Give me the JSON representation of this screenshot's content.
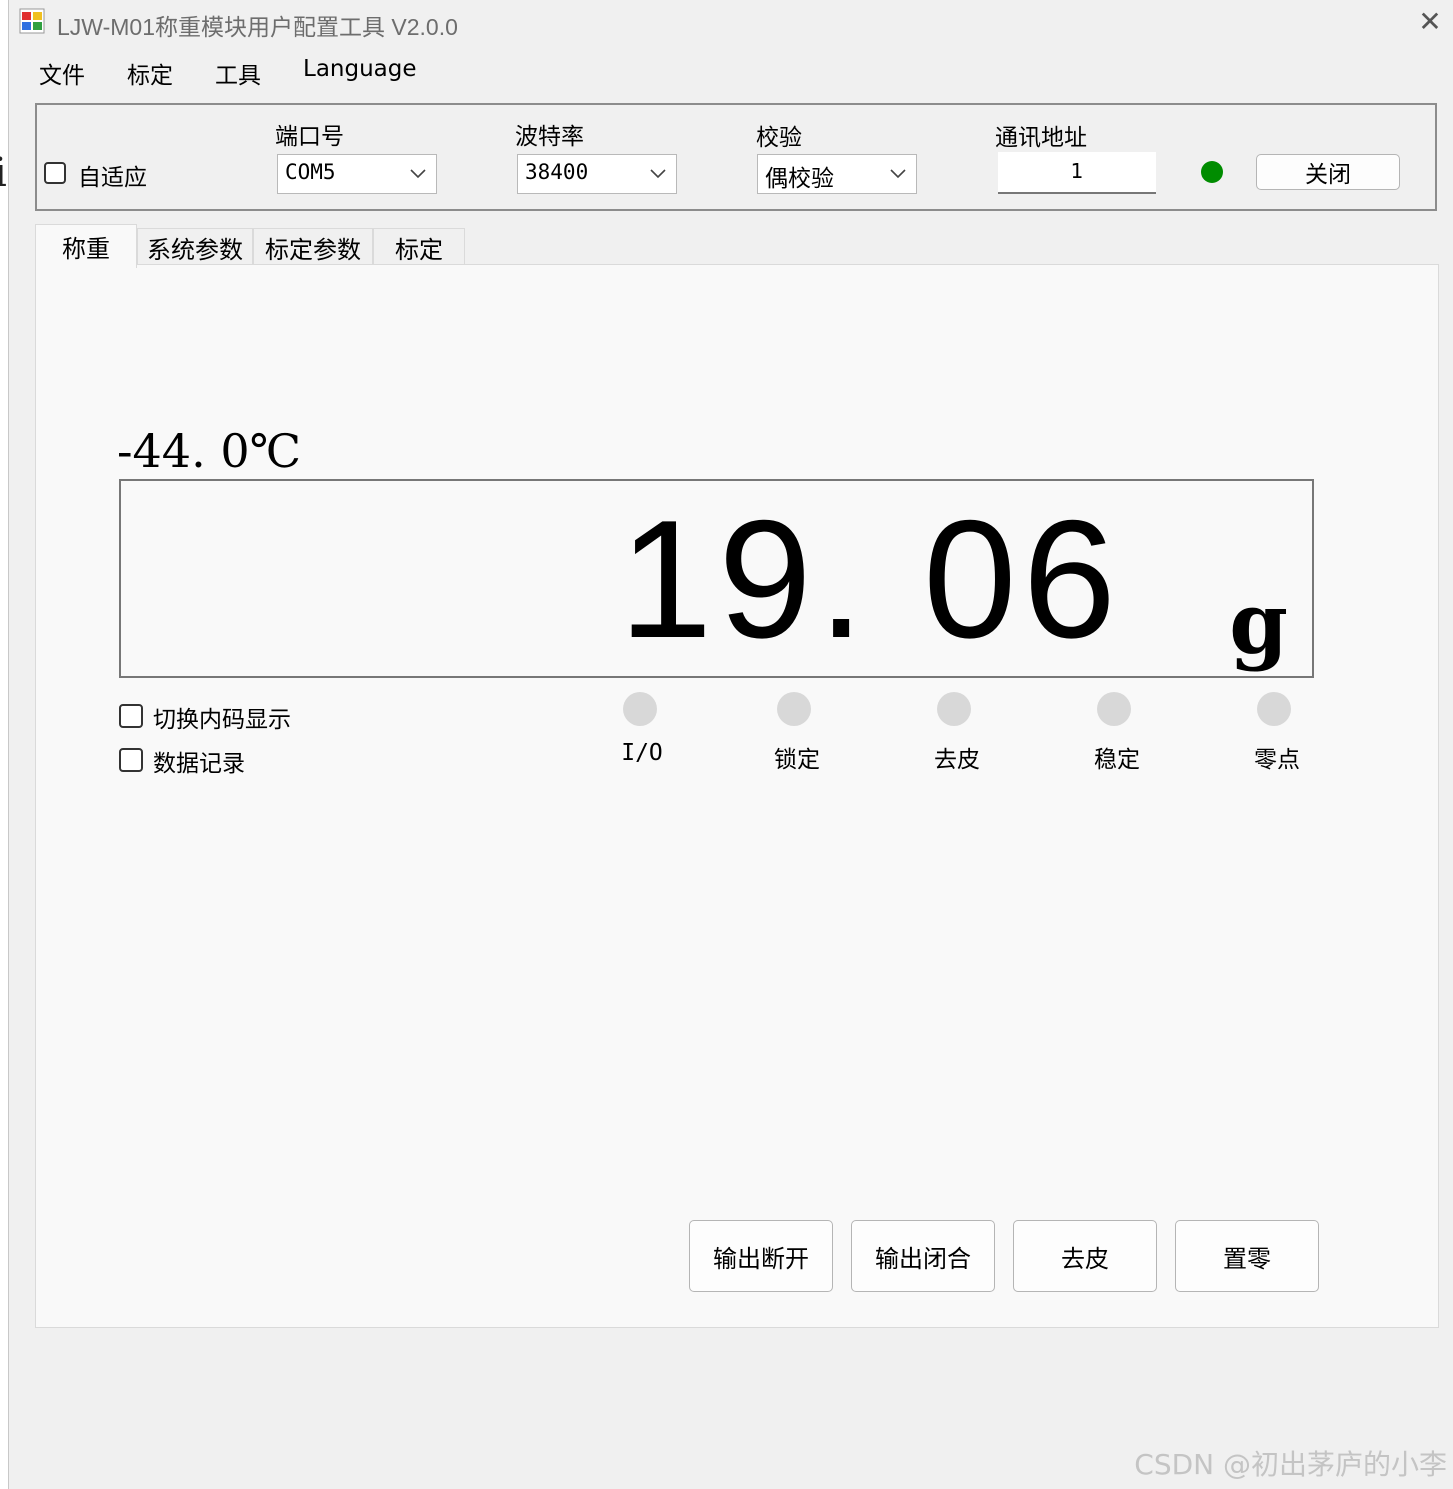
{
  "window": {
    "title": "LJW-M01称重模块用户配置工具 V2.0.0",
    "close_glyph": "✕"
  },
  "menu": [
    "文件",
    "标定",
    "工具",
    "Language"
  ],
  "connection": {
    "adaptive_label": "自适应",
    "adaptive_checked": false,
    "port_label": "端口号",
    "port_value": "COM5",
    "baud_label": "波特率",
    "baud_value": "38400",
    "parity_label": "校验",
    "parity_value": "偶校验",
    "address_label": "通讯地址",
    "address_value": "1",
    "status_led_color": "#008c00",
    "close_button_label": "关闭"
  },
  "tabs": [
    "称重",
    "系统参数",
    "标定参数",
    "标定"
  ],
  "active_tab": "称重",
  "weighing": {
    "temperature": "-44. 0℃",
    "weight_value": "19. 06",
    "weight_unit": "g",
    "switch_code_label": "切换内码显示",
    "data_record_label": "数据记录",
    "indicators": [
      {
        "label": "I/O",
        "active": false
      },
      {
        "label": "锁定",
        "active": false
      },
      {
        "label": "去皮",
        "active": false
      },
      {
        "label": "稳定",
        "active": false
      },
      {
        "label": "零点",
        "active": false
      }
    ],
    "buttons": {
      "output_off": "输出断开",
      "output_on": "输出闭合",
      "tare": "去皮",
      "zero": "置零"
    }
  },
  "watermark": "CSDN @初出茅庐的小李"
}
